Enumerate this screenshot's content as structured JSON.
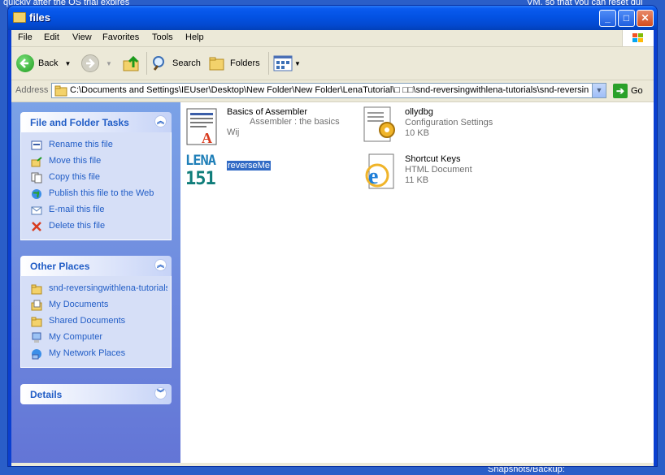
{
  "desktop": {
    "bg_text_top_left": "quickly after the OS trial expires",
    "bg_text_top_right": "VM, so that you can reset qui",
    "bg_text_bottom_right": "Snapshots/Backup:"
  },
  "window": {
    "title": "files",
    "controls": {
      "minimize": "_",
      "maximize": "□",
      "close": "✕"
    }
  },
  "menubar": {
    "items": [
      "File",
      "Edit",
      "View",
      "Favorites",
      "Tools",
      "Help"
    ]
  },
  "toolbar": {
    "back_label": "Back",
    "search_label": "Search",
    "folders_label": "Folders"
  },
  "addressbar": {
    "label": "Address",
    "value": "C:\\Documents and Settings\\IEUser\\Desktop\\New Folder\\New Folder\\LenaTutorial\\□ □□\\snd-reversingwithlena-tutorials\\snd-reversin",
    "go_label": "Go"
  },
  "tasks_panel": {
    "title": "File and Folder Tasks",
    "items": [
      {
        "label": "Rename this file",
        "icon": "rename-icon"
      },
      {
        "label": "Move this file",
        "icon": "move-icon"
      },
      {
        "label": "Copy this file",
        "icon": "copy-icon"
      },
      {
        "label": "Publish this file to the Web",
        "icon": "publish-icon"
      },
      {
        "label": "E-mail this file",
        "icon": "email-icon"
      },
      {
        "label": "Delete this file",
        "icon": "delete-icon"
      }
    ]
  },
  "places_panel": {
    "title": "Other Places",
    "items": [
      {
        "label": "snd-reversingwithlena-tutorials",
        "icon": "folder-icon"
      },
      {
        "label": "My Documents",
        "icon": "my-documents-icon"
      },
      {
        "label": "Shared Documents",
        "icon": "folder-icon"
      },
      {
        "label": "My Computer",
        "icon": "computer-icon"
      },
      {
        "label": "My Network Places",
        "icon": "network-icon"
      }
    ]
  },
  "details_panel": {
    "title": "Details"
  },
  "files": [
    {
      "name": "Basics of Assembler",
      "line2": "Assembler : the basics",
      "line3": "Wij",
      "icon": "word-document-icon"
    },
    {
      "name": "ollydbg",
      "line2": "Configuration Settings",
      "line3": "10 KB",
      "icon": "config-file-icon"
    },
    {
      "name": "reverseMe",
      "line2": "",
      "line3": "",
      "icon": "lena151-icon",
      "icon_text_top": "LENA",
      "icon_text_bottom": "151"
    },
    {
      "name": "Shortcut Keys",
      "line2": "HTML Document",
      "line3": "11 KB",
      "icon": "html-document-icon"
    }
  ]
}
